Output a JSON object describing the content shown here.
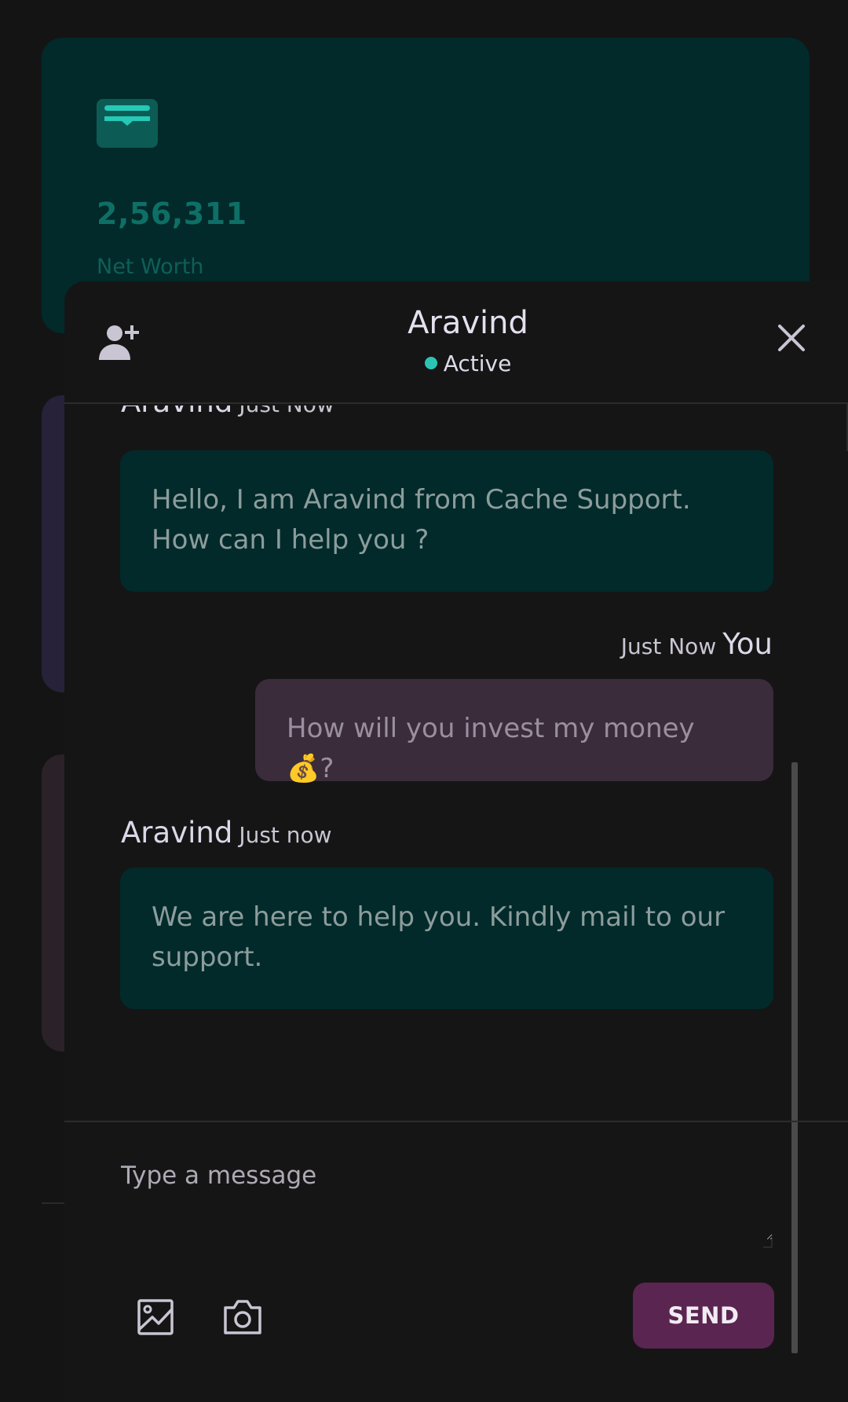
{
  "dashboard": {
    "net_worth_value": "2,56,311",
    "net_worth_label": "Net Worth",
    "wallet_icon": "wallet-icon",
    "colors": {
      "card_teal": "#022a2a",
      "accent_teal": "#0e6f66"
    }
  },
  "chat": {
    "contact_name": "Aravind",
    "status": "Active",
    "status_color": "#2bc4b4",
    "add_user_icon": "add-user-icon",
    "close_icon": "close-icon",
    "messages": [
      {
        "sender": "Aravind",
        "time": "Just Now",
        "text_line1": "Hello, I am Aravind from Cache Support.",
        "text_line2": "How can I help you ?"
      },
      {
        "sender": "You",
        "time": "Just Now",
        "text": "How will you invest my money 💰?"
      },
      {
        "sender": "Aravind",
        "time": "Just now",
        "text_line1": "We are here to help you. Kindly mail to our",
        "text_line2": "support."
      }
    ],
    "input_placeholder": "Type a message",
    "attach_image_icon": "image-icon",
    "camera_icon": "camera-icon",
    "send_label": "SEND",
    "colors": {
      "incoming_bubble": "#022a2a",
      "outgoing_bubble": "#3a2c3a",
      "send_button": "#5a2550"
    }
  }
}
